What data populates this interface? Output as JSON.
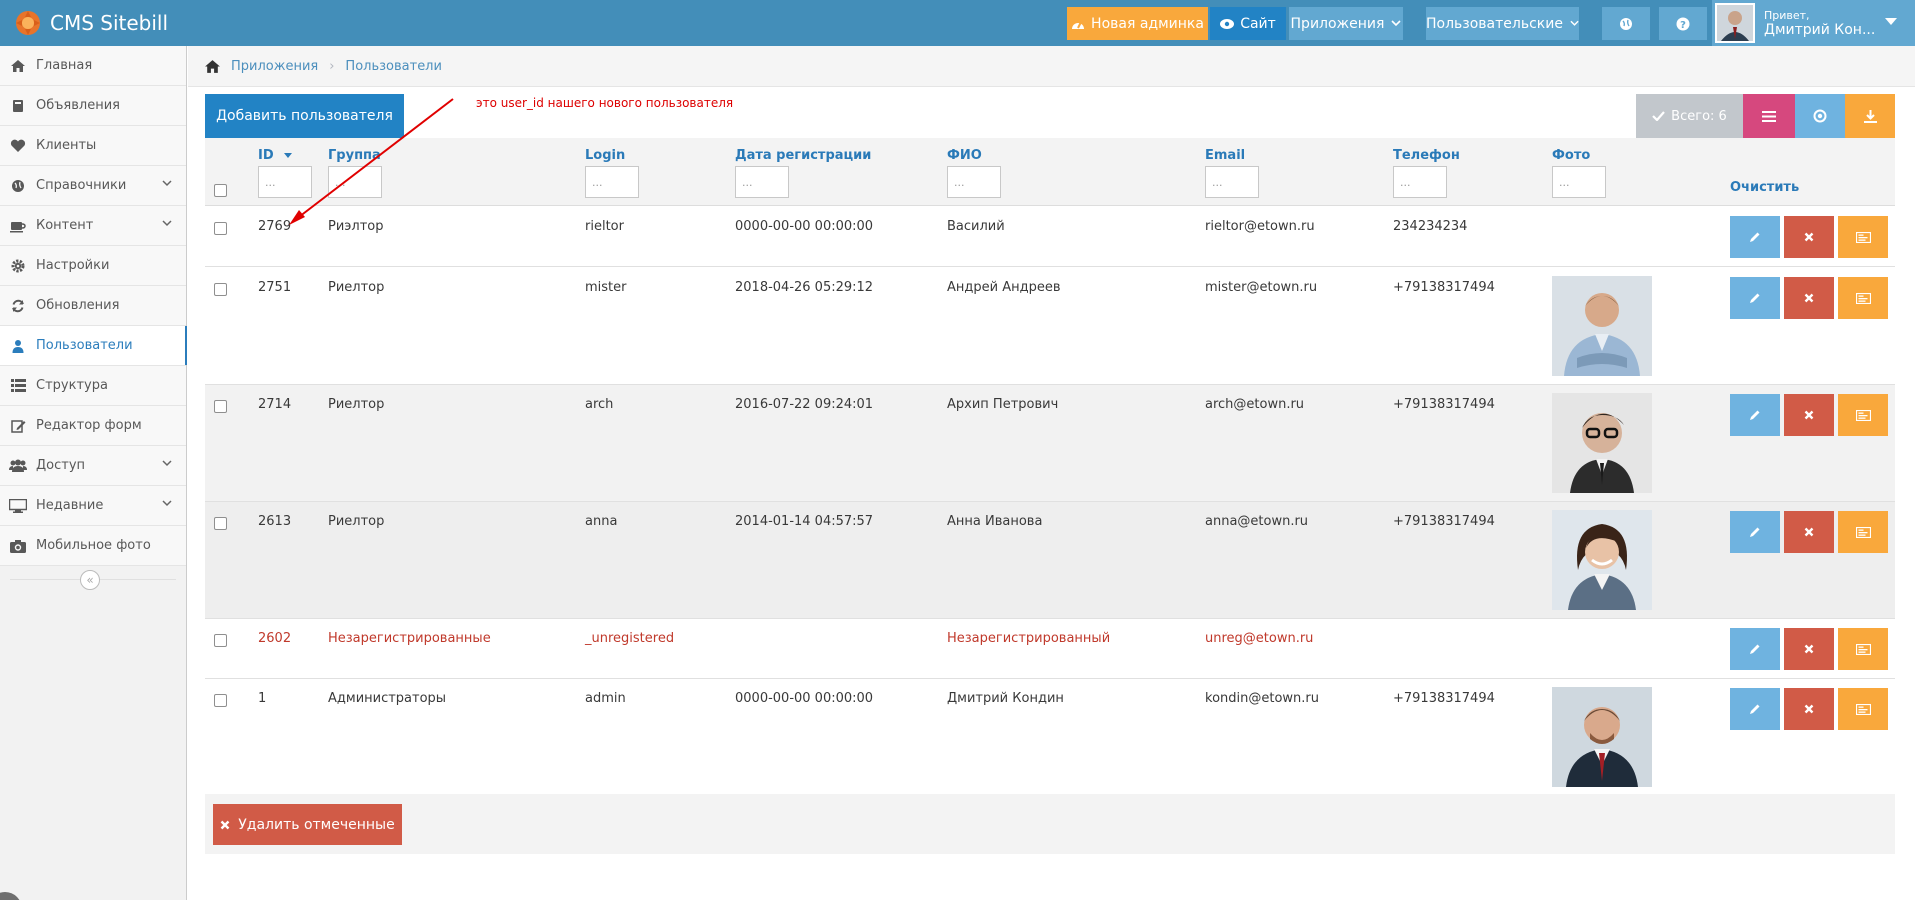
{
  "navbar": {
    "brand": "CMS Sitebill",
    "new_admin": "Новая админка",
    "site": "Сайт",
    "apps": "Приложения",
    "users_menu": "Пользовательские",
    "user_hello": "Привет,",
    "user_name": "Дмитрий Кон..."
  },
  "sidebar": {
    "items": [
      {
        "label": "Главная",
        "icon": "home-icon"
      },
      {
        "label": "Объявления",
        "icon": "book-icon"
      },
      {
        "label": "Клиенты",
        "icon": "heart-icon"
      },
      {
        "label": "Справочники",
        "icon": "globe-icon"
      },
      {
        "label": "Контент",
        "icon": "coffee-icon"
      },
      {
        "label": "Настройки",
        "icon": "gear-icon"
      },
      {
        "label": "Обновления",
        "icon": "refresh-icon"
      },
      {
        "label": "Пользователи",
        "icon": "user-icon"
      },
      {
        "label": "Структура",
        "icon": "list-icon"
      },
      {
        "label": "Редактор форм",
        "icon": "edit-icon"
      },
      {
        "label": "Доступ",
        "icon": "users-icon"
      },
      {
        "label": "Недавние",
        "icon": "desktop-icon"
      },
      {
        "label": "Мобильное фото",
        "icon": "camera-icon"
      }
    ]
  },
  "breadcrumb": {
    "apps": "Приложения",
    "users": "Пользователи"
  },
  "toolbar": {
    "add_user": "Добавить пользователя",
    "annotation": "это user_id нашего нового пользователя",
    "total": "Всего: 6"
  },
  "grid": {
    "columns": [
      "ID",
      "Группа",
      "Login",
      "Дата регистрации",
      "ФИО",
      "Email",
      "Телефон",
      "Фото"
    ],
    "filter_placeholder": "...",
    "clear": "Очистить",
    "rows": [
      {
        "id": "2769",
        "group": "Риэлтор",
        "login": "rieltor",
        "date": "0000-00-00 00:00:00",
        "fio": "Василий",
        "email": "rieltor@etown.ru",
        "phone": "234234234"
      },
      {
        "id": "2751",
        "group": "Риелтор",
        "login": "mister",
        "date": "2018-04-26 05:29:12",
        "fio": "Андрей Андреев",
        "email": "mister@etown.ru",
        "phone": "+79138317494"
      },
      {
        "id": "2714",
        "group": "Риелтор",
        "login": "arch",
        "date": "2016-07-22 09:24:01",
        "fio": "Архип Петрович",
        "email": "arch@etown.ru",
        "phone": "+79138317494"
      },
      {
        "id": "2613",
        "group": "Риелтор",
        "login": "anna",
        "date": "2014-01-14 04:57:57",
        "fio": "Анна Иванова",
        "email": "anna@etown.ru",
        "phone": "+79138317494"
      },
      {
        "id": "2602",
        "group": "Незарегистрированные",
        "login": "_unregistered",
        "date": "",
        "fio": "Незарегистрированный",
        "email": "unreg@etown.ru",
        "phone": ""
      },
      {
        "id": "1",
        "group": "Администраторы",
        "login": "admin",
        "date": "0000-00-00 00:00:00",
        "fio": "Дмитрий Кондин",
        "email": "kondin@etown.ru",
        "phone": "+79138317494"
      }
    ]
  },
  "footer": {
    "delete_checked": "Удалить отмеченные"
  },
  "colors": {
    "primary": "#2283c5",
    "danger": "#d15b47",
    "warning": "#f9a83c",
    "info": "#6fb3e0",
    "pink": "#d6487e",
    "navbar": "#438eb9"
  }
}
